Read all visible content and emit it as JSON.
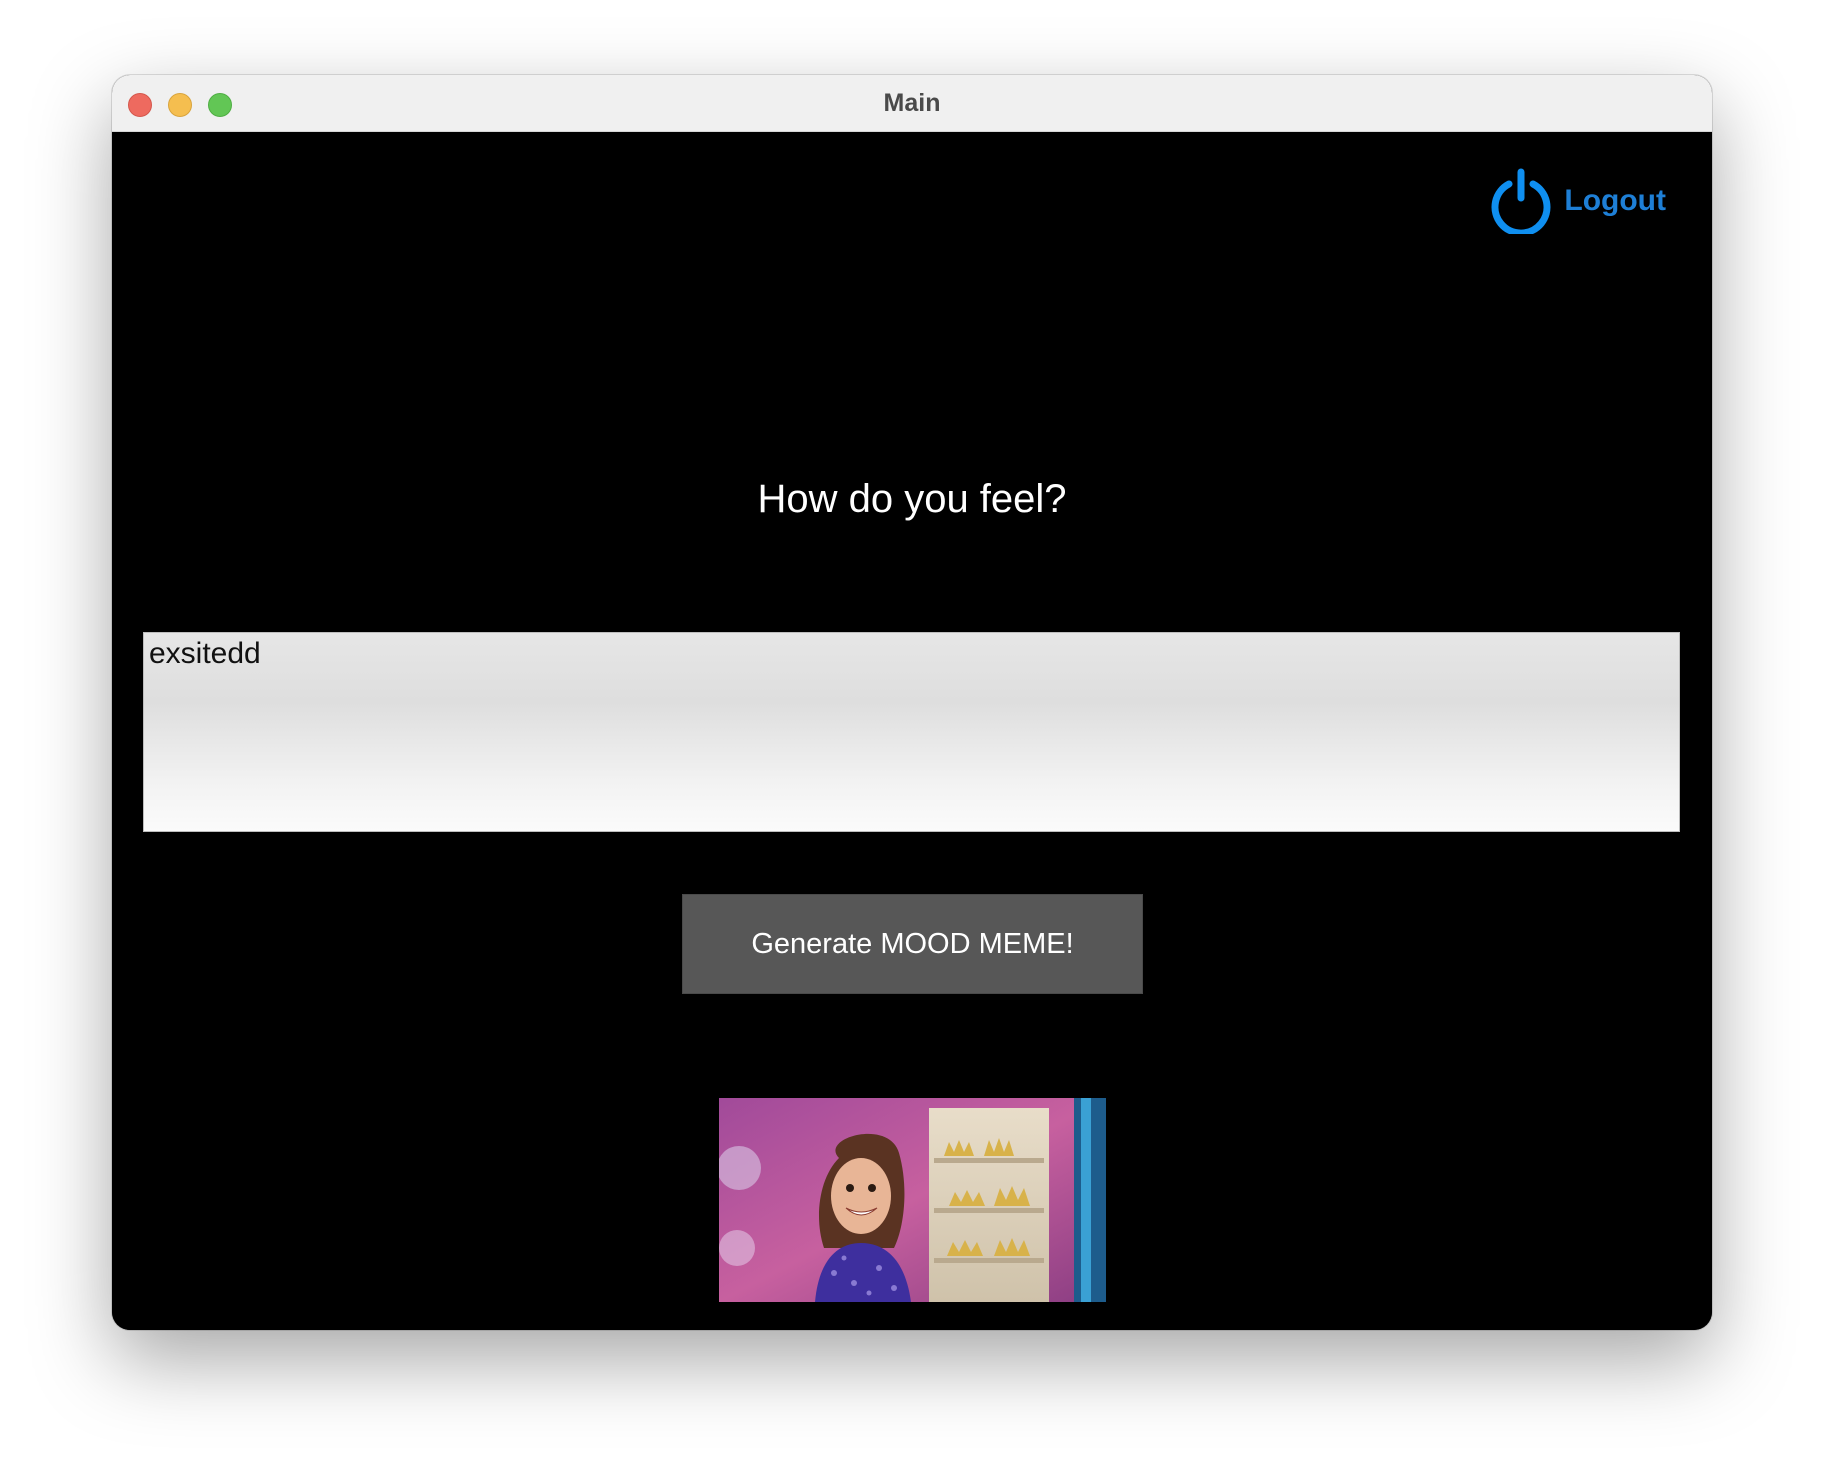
{
  "window": {
    "title": "Main"
  },
  "header": {
    "logout_label": "Logout",
    "logout_icon": "power-icon",
    "accent_color": "#1e8fe6"
  },
  "main": {
    "question": "How do you feel?",
    "mood_input_value": "exsitedd",
    "generate_button_label": "Generate MOOD MEME!",
    "meme_image": "excited-girl-meme"
  }
}
